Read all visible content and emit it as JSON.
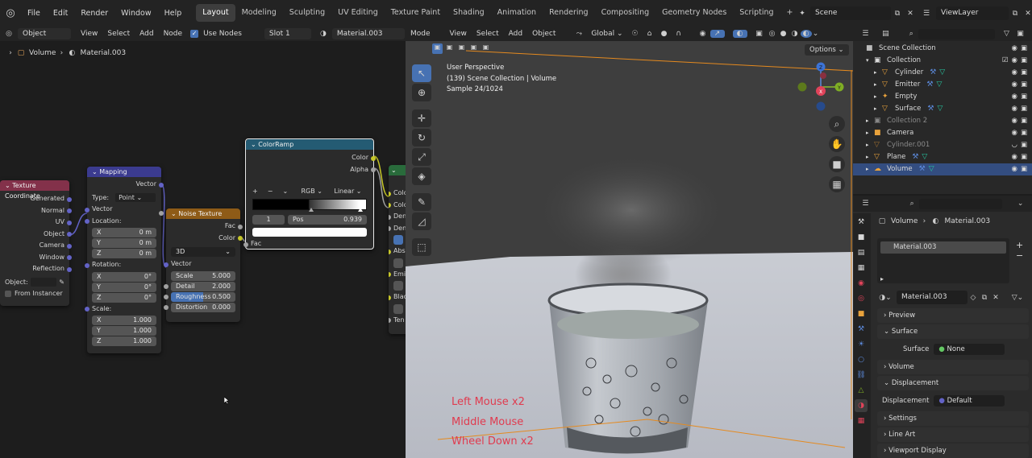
{
  "topbar": {
    "menus": [
      "File",
      "Edit",
      "Render",
      "Window",
      "Help"
    ],
    "workspaces": [
      "Layout",
      "Modeling",
      "Sculpting",
      "UV Editing",
      "Texture Paint",
      "Shading",
      "Animation",
      "Rendering",
      "Compositing",
      "Geometry Nodes",
      "Scripting"
    ],
    "active_workspace": "Layout",
    "add_tab": "+",
    "scene": "Scene",
    "view_layer": "ViewLayer"
  },
  "node_editor": {
    "header": {
      "mode": "Object",
      "view": "View",
      "select": "Select",
      "add": "Add",
      "node": "Node",
      "use_nodes": "Use Nodes",
      "slot": "Slot 1",
      "material": "Material.003"
    },
    "breadcrumb": {
      "object": "Volume",
      "material": "Material.003"
    },
    "nodes": {
      "texcoord": {
        "title": "Texture Coordinate",
        "outputs": [
          "Generated",
          "Normal",
          "UV",
          "Object",
          "Camera",
          "Window",
          "Reflection"
        ],
        "object_label": "Object:",
        "from_instancer": "From Instancer"
      },
      "mapping": {
        "title": "Mapping",
        "output": "Vector",
        "type_label": "Type:",
        "type_value": "Point",
        "input": "Vector",
        "location_label": "Location:",
        "location": [
          {
            "axis": "X",
            "val": "0 m"
          },
          {
            "axis": "Y",
            "val": "0 m"
          },
          {
            "axis": "Z",
            "val": "0 m"
          }
        ],
        "rotation_label": "Rotation:",
        "rotation": [
          {
            "axis": "X",
            "val": "0°"
          },
          {
            "axis": "Y",
            "val": "0°"
          },
          {
            "axis": "Z",
            "val": "0°"
          }
        ],
        "scale_label": "Scale:",
        "scale": [
          {
            "axis": "X",
            "val": "1.000"
          },
          {
            "axis": "Y",
            "val": "1.000"
          },
          {
            "axis": "Z",
            "val": "1.000"
          }
        ]
      },
      "noise": {
        "title": "Noise Texture",
        "outputs": [
          "Fac",
          "Color"
        ],
        "dimension": "3D",
        "input_vector": "Vector",
        "fields": [
          {
            "label": "Scale",
            "val": "5.000"
          },
          {
            "label": "Detail",
            "val": "2.000"
          },
          {
            "label": "Roughness",
            "val": "0.500"
          },
          {
            "label": "Distortion",
            "val": "0.000"
          }
        ]
      },
      "colorramp": {
        "title": "ColorRamp",
        "outputs": [
          "Color",
          "Alpha"
        ],
        "plus": "+",
        "minus": "−",
        "mode": "RGB",
        "interp": "Linear",
        "stop_index": "1",
        "pos_label": "Pos",
        "pos_val": "0.939",
        "input": "Fac"
      },
      "principled_partial": {
        "sockets": [
          "Colo",
          "Colo",
          "Den",
          "Den",
          "",
          "Abs",
          "Emi",
          "",
          "Blac",
          "",
          "Ten"
        ]
      }
    }
  },
  "viewport": {
    "header": {
      "mode": "Mode",
      "view": "View",
      "select": "Select",
      "add": "Add",
      "object": "Object",
      "transform": "Global"
    },
    "options": "Options",
    "info": [
      "User Perspective",
      "(139) Scene Collection | Volume",
      "Sample 24/1024"
    ],
    "overlay_text": [
      "Left Mouse x2",
      "Middle Mouse",
      "Wheel Down x2"
    ],
    "gizmo": {
      "x": "X",
      "y": "Y",
      "z": "Z"
    }
  },
  "outliner": {
    "search_placeholder": "",
    "rows": [
      {
        "label": "Scene Collection",
        "indent": 0,
        "type": "scene"
      },
      {
        "label": "Collection",
        "indent": 1,
        "type": "collection"
      },
      {
        "label": "Cylinder",
        "indent": 2,
        "type": "object"
      },
      {
        "label": "Emitter",
        "indent": 2,
        "type": "object"
      },
      {
        "label": "Empty",
        "indent": 2,
        "type": "empty"
      },
      {
        "label": "Surface",
        "indent": 2,
        "type": "object"
      },
      {
        "label": "Collection 2",
        "indent": 1,
        "type": "collection-dim"
      },
      {
        "label": "Camera",
        "indent": 1,
        "type": "camera"
      },
      {
        "label": "Cylinder.001",
        "indent": 1,
        "type": "dim"
      },
      {
        "label": "Plane",
        "indent": 1,
        "type": "object"
      },
      {
        "label": "Volume",
        "indent": 1,
        "type": "selected"
      }
    ]
  },
  "properties": {
    "breadcrumb": {
      "object": "Volume",
      "material": "Material.003"
    },
    "slot_name": "Material.003",
    "material_name": "Material.003",
    "panels": {
      "preview": "Preview",
      "surface": "Surface",
      "surface_label": "Surface",
      "surface_value": "None",
      "volume": "Volume",
      "displacement": "Displacement",
      "displacement_label": "Displacement",
      "displacement_value": "Default",
      "settings": "Settings",
      "lineart": "Line Art",
      "viewport_display": "Viewport Display"
    }
  },
  "colors": {
    "accent": "#4772b3",
    "input_node": "#83314a",
    "vector_node": "#3b3b8f",
    "texture_node": "#8e5b17",
    "converter_node": "#245b73",
    "shader_node": "#296b3b",
    "overlay_text": "#e03b4f"
  }
}
